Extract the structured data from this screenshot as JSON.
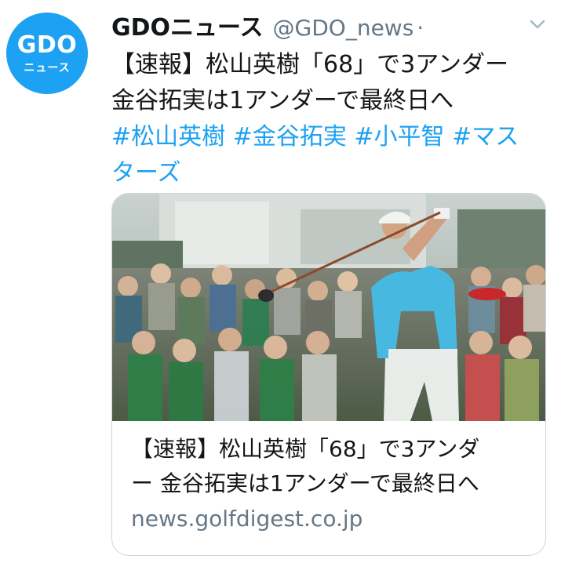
{
  "tweet": {
    "avatar": {
      "logo_text": "GDO",
      "logo_sub": "ニュース",
      "bg_color": "#1da1f2"
    },
    "author_name": "GDOニュース",
    "author_handle": "@GDO_news",
    "separator": "·",
    "text_lines": [
      "【速報】松山英樹「68」で3アンダー",
      "金谷拓実は1アンダーで最終日へ"
    ],
    "hashtags_line1": [
      "#松山英樹",
      "#金谷拓実",
      "#小平智",
      "#マス"
    ],
    "hashtags_line2": "ターズ",
    "link_color": "#1da1f2"
  },
  "card": {
    "image_icon": "golf-photo-image",
    "title_lines": [
      "【速報】松山英樹「68」で3アンダ",
      "ー 金谷拓実は1アンダーで最終日へ"
    ],
    "domain": "news.golfdigest.co.jp"
  },
  "icons": {
    "menu": "chevron-down-icon"
  }
}
